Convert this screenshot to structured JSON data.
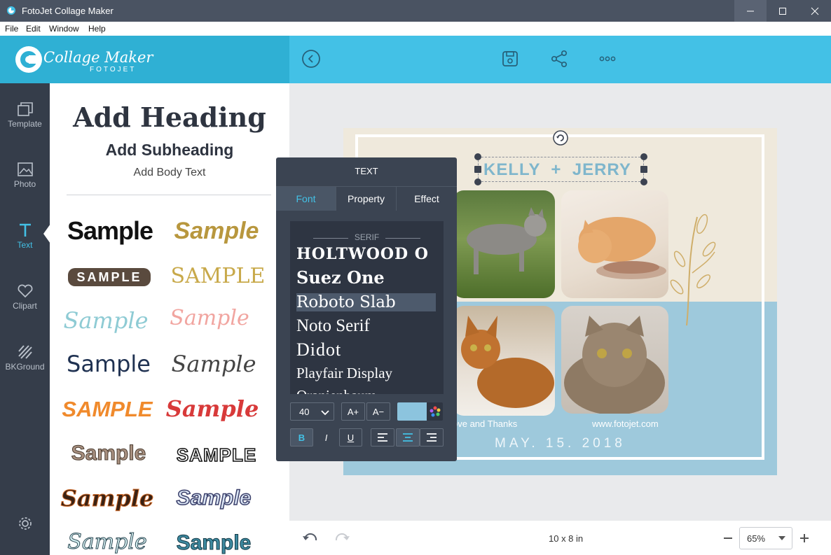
{
  "window": {
    "title": "FotoJet Collage Maker"
  },
  "menu": [
    "File",
    "Edit",
    "Window",
    "Help"
  ],
  "logo": {
    "text": "Collage Maker",
    "sub": "FOTOJET"
  },
  "sidebar": {
    "items": [
      {
        "label": "Template"
      },
      {
        "label": "Photo"
      },
      {
        "label": "Text"
      },
      {
        "label": "Clipart"
      },
      {
        "label": "BKGround"
      }
    ]
  },
  "text_panel": {
    "heading": "Add Heading",
    "subheading": "Add Subheading",
    "body": "Add Body Text",
    "samples": [
      "Sample",
      "Sample",
      "SAMPLE",
      "SAMPLE",
      "Sample",
      "Sample",
      "Sample",
      "Sample",
      "SAMPLE",
      "Sample",
      "Sample",
      "SAMPLE",
      "Sample",
      "Sample",
      "Sample",
      "Sample"
    ]
  },
  "popup": {
    "title": "TEXT",
    "tabs": [
      "Font",
      "Property",
      "Effect"
    ],
    "category": "SERIF",
    "fonts": [
      "HOLTWOOD O",
      "Suez One",
      "Roboto Slab",
      "Noto Serif",
      "Didot",
      "Playfair Display",
      "Oranienbaum"
    ],
    "selected_font": "Roboto Slab",
    "size": "40",
    "increase": "A+",
    "decrease": "A−",
    "bold": "B",
    "italic": "I",
    "underline": "U",
    "color": "#8cc4de"
  },
  "canvas": {
    "headline": "KELLY  +  JERRY",
    "caption_left": "ove and Thanks",
    "caption_right": "www.fotojet.com",
    "date": "MAY. 15. 2018"
  },
  "bottom": {
    "size": "10 x 8 in",
    "zoom": "65%"
  }
}
